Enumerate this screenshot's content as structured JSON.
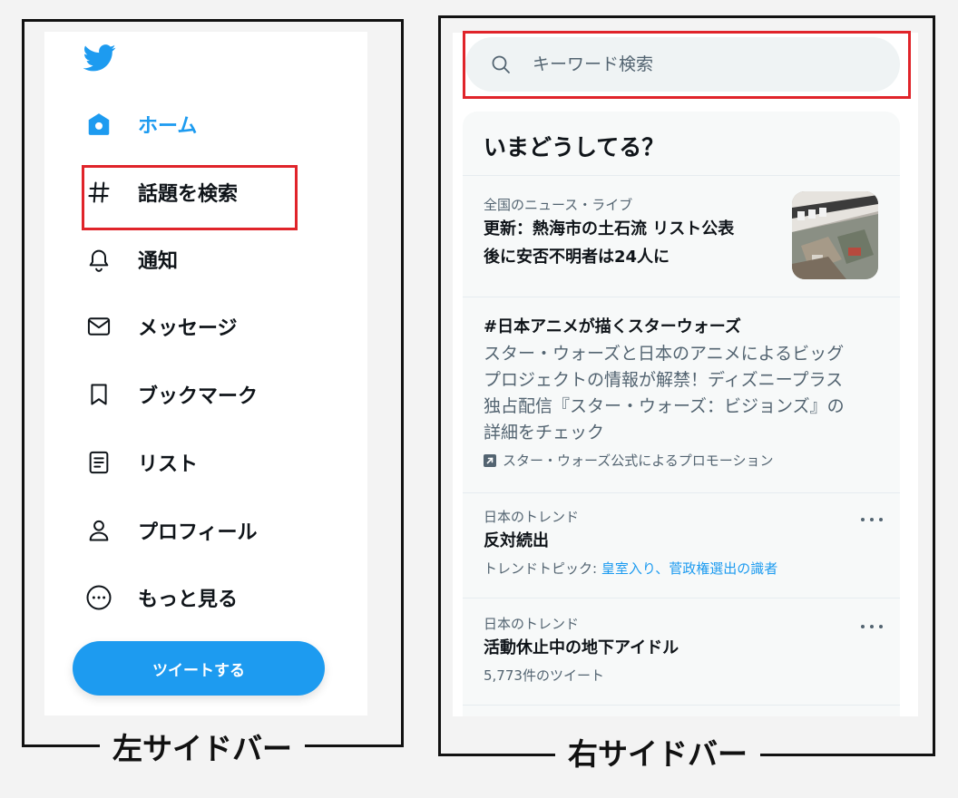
{
  "left_sidebar": {
    "caption": "左サイドバー",
    "nav": [
      {
        "id": "home",
        "label": "ホーム",
        "active": true
      },
      {
        "id": "explore",
        "label": "話題を検索",
        "active": false
      },
      {
        "id": "notifications",
        "label": "通知",
        "active": false
      },
      {
        "id": "messages",
        "label": "メッセージ",
        "active": false
      },
      {
        "id": "bookmarks",
        "label": "ブックマーク",
        "active": false
      },
      {
        "id": "lists",
        "label": "リスト",
        "active": false
      },
      {
        "id": "profile",
        "label": "プロフィール",
        "active": false
      },
      {
        "id": "more",
        "label": "もっと見る",
        "active": false
      }
    ],
    "tweet_button": "ツイートする"
  },
  "right_sidebar": {
    "caption": "右サイドバー",
    "search": {
      "placeholder": "キーワード検索"
    },
    "trends_title": "いまどうしてる？",
    "trends": [
      {
        "meta": "全国のニュース・ライブ",
        "headline_line1": "更新：熱海市の土石流 リスト公表",
        "headline_line2": "後に安否不明者は24人に"
      },
      {
        "headline": "#日本アニメが描くスターウォーズ",
        "desc_lines": [
          "スター・ウォーズと日本のアニメによるビッグ",
          "プロジェクトの情報が解禁！ディズニープラス",
          "独占配信『スター・ウォーズ：ビジョンズ』の",
          "詳細をチェック"
        ],
        "promo": "スター・ウォーズ公式によるプロモーション"
      },
      {
        "meta": "日本のトレンド",
        "headline": "反対続出",
        "sub_prefix": "トレンドトピック: ",
        "sub_link": "皇室入り、菅政権選出の識者"
      },
      {
        "meta": "日本のトレンド",
        "headline": "活動休止中の地下アイドル",
        "sub": "5,773件のツイート"
      }
    ]
  },
  "colors": {
    "accent": "#1d9bf0",
    "highlight": "#e0242a",
    "text_primary": "#0f1419",
    "text_secondary": "#536471"
  },
  "icons": {
    "logo": "twitter-bird-icon",
    "home": "home-icon",
    "explore": "hashtag-icon",
    "notifications": "bell-icon",
    "messages": "envelope-icon",
    "bookmarks": "bookmark-icon",
    "lists": "list-document-icon",
    "profile": "person-icon",
    "more": "more-circle-icon",
    "search": "search-icon",
    "trend_more": "more-horizontal-icon",
    "promo": "promoted-arrow-icon"
  }
}
